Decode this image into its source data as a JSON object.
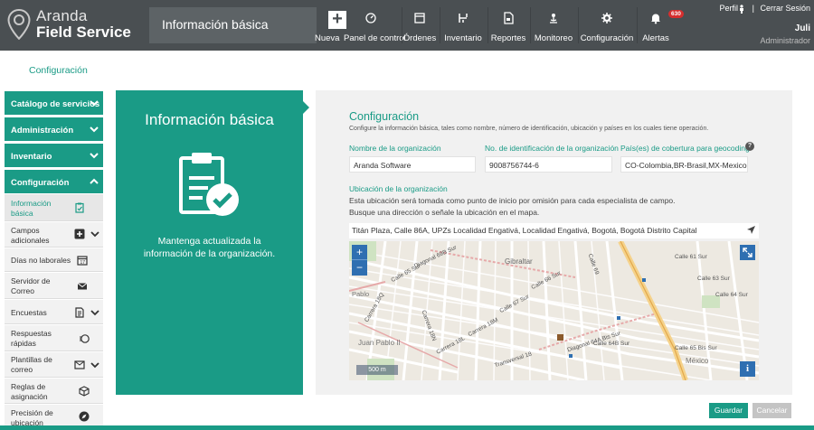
{
  "brand": {
    "line1": "Aranda",
    "line2": "Field Service"
  },
  "header": {
    "title": "Información básica"
  },
  "nav": [
    {
      "label": "Nueva",
      "icon": "plus-icon"
    },
    {
      "label": "Panel de control",
      "icon": "dashboard-icon"
    },
    {
      "label": "Órdenes",
      "icon": "orders-icon"
    },
    {
      "label": "Inventario",
      "icon": "inventory-icon"
    },
    {
      "label": "Reportes",
      "icon": "reports-icon"
    },
    {
      "label": "Monitoreo",
      "icon": "monitor-icon"
    },
    {
      "label": "Configuración",
      "icon": "gear-icon"
    },
    {
      "label": "Alertas",
      "icon": "bell-icon",
      "badge": "630"
    }
  ],
  "user": {
    "profile": "Perfil",
    "separator": "|",
    "logout": "Cerrar Sesión",
    "name": "Juli",
    "role": "Administrador"
  },
  "breadcrumb": "Configuración",
  "sidebar": {
    "sections": [
      "Catálogo de servicios",
      "Administración",
      "Inventario",
      "Configuración"
    ],
    "items": [
      {
        "label": "Información básica",
        "icon": "clipboard-check-icon",
        "active": true
      },
      {
        "label": "Campos adicionales",
        "icon": "plus-square-icon",
        "expandable": true
      },
      {
        "label": "Días no laborales",
        "icon": "calendar-icon"
      },
      {
        "label": "Servidor de Correo",
        "icon": "envelope-icon"
      },
      {
        "label": "Encuestas",
        "icon": "survey-icon",
        "expandable": true
      },
      {
        "label": "Respuestas rápidas",
        "icon": "quick-reply-icon"
      },
      {
        "label": "Plantillas de correo",
        "icon": "mail-template-icon",
        "expandable": true
      },
      {
        "label": "Reglas de asignación",
        "icon": "cube-icon"
      },
      {
        "label": "Precisión de ubicación",
        "icon": "navigation-icon"
      }
    ]
  },
  "card": {
    "title": "Información básica",
    "text": "Mantenga actualizada la información de la organización."
  },
  "form": {
    "title": "Configuración",
    "description": "Configure la información básica, tales como nombre, número de identificación, ubicación y países en los cuales tiene operación.",
    "org_name_label": "Nombre de la organización",
    "org_name": "Aranda Software",
    "org_id_label": "No. de identificación de la organización",
    "org_id": "9008756744-6",
    "countries_label": "País(es) de cobertura para geocoding",
    "countries": "CO-Colombia,BR-Brasil,MX-Mexico,PE-Peru",
    "location_label": "Ubicación de la organización",
    "location_hint1": "Esta ubicación será tomada como punto de inicio por omisión para cada especialista de campo.",
    "location_hint2": "Busque una dirección o señale la ubicación en el mapa.",
    "address": "Titán Plaza, Calle 86A, UPZs Localidad Engativá, Localidad Engativá, Bogotá, Bogotá Distrito Capital"
  },
  "map": {
    "zoom_in": "+",
    "zoom_out": "−",
    "scale": "500 m",
    "info": "i",
    "labels": [
      "Diagonal 69B Sur",
      "Calle 65 Sur",
      "Gibraltar",
      "Calle 66 Sur",
      "Pablo",
      "Carrera 18Q",
      "Calle 69",
      "Carrera 18N",
      "Carrera 18M",
      "Calle 67 Sur",
      "Carrera 18L",
      "Calle 64 Sur",
      "Calle 63 Sur",
      "Calle 61 Sur",
      "Diagonal 64A Bis Sur",
      "Calle 64B Sur",
      "Calle 65 Bis Sur",
      "México",
      "Juan Pablo II",
      "Transversal 18"
    ]
  },
  "buttons": {
    "save": "Guardar",
    "cancel": "Cancelar"
  },
  "colors": {
    "accent": "#1a9b86",
    "topbar": "#4a4f52",
    "badge": "#d62e2e",
    "map_control": "#2f6fb1"
  }
}
